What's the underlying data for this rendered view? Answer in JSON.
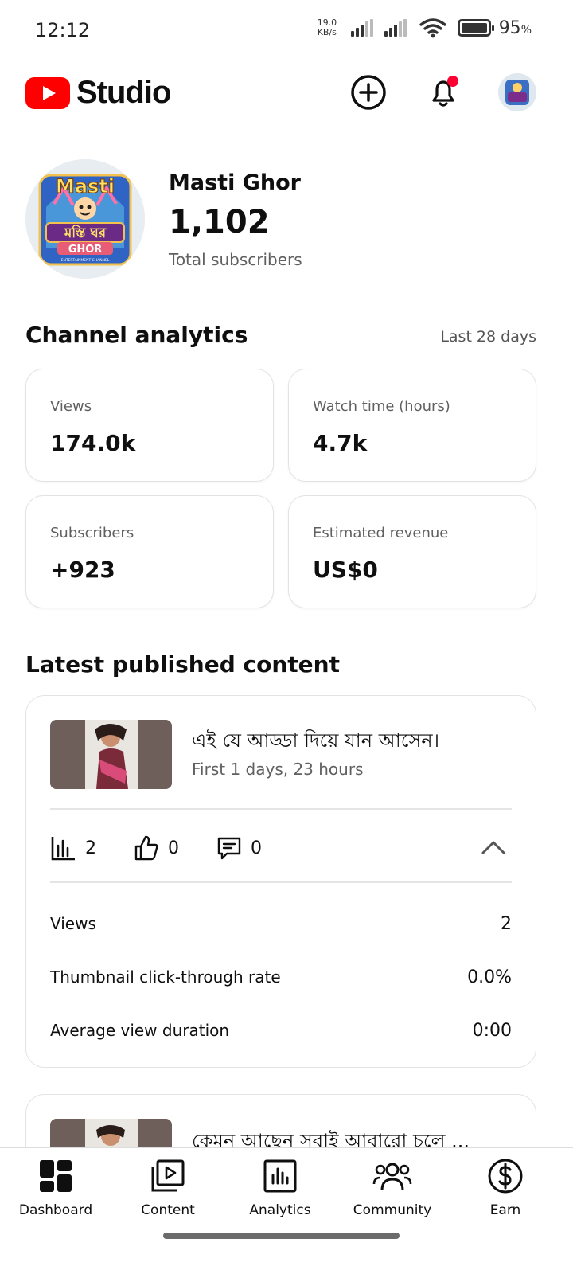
{
  "status_bar": {
    "time": "12:12",
    "net_speed_value": "19.0",
    "net_speed_unit": "KB/s",
    "battery": "95",
    "battery_unit": "%"
  },
  "header": {
    "app_name": "Studio",
    "brand_color": "#FF0000",
    "notification_dot_color": "#FF0033"
  },
  "channel": {
    "name": "Masti Ghor",
    "subscriber_count": "1,102",
    "subscriber_label": "Total subscribers",
    "logo_text_top": "Masti",
    "logo_text_mid": "মস্তি ঘর",
    "logo_text_bottom": "GHOR",
    "logo_caption": "ENTERTAINMENT CHANNEL"
  },
  "analytics": {
    "title": "Channel analytics",
    "period": "Last 28 days",
    "cards": [
      {
        "label": "Views",
        "value": "174.0k"
      },
      {
        "label": "Watch time (hours)",
        "value": "4.7k"
      },
      {
        "label": "Subscribers",
        "value": "+923"
      },
      {
        "label": "Estimated revenue",
        "value": "US$0"
      }
    ]
  },
  "latest": {
    "title": "Latest published content",
    "video": {
      "title": "এই যে আড্ডা দিয়ে যান  আসেন।",
      "subtitle": "First 1 days, 23 hours",
      "views": "2",
      "likes": "0",
      "comments": "0",
      "details": [
        {
          "label": "Views",
          "value": "2"
        },
        {
          "label": "Thumbnail click-through rate",
          "value": "0.0%"
        },
        {
          "label": "Average view duration",
          "value": "0:00"
        }
      ]
    },
    "next_video": {
      "title": "কেমন আছেন সবাই আবারো চলে ..."
    }
  },
  "nav": {
    "items": [
      {
        "label": "Dashboard",
        "icon": "dashboard-icon"
      },
      {
        "label": "Content",
        "icon": "content-icon"
      },
      {
        "label": "Analytics",
        "icon": "analytics-icon"
      },
      {
        "label": "Community",
        "icon": "community-icon"
      },
      {
        "label": "Earn",
        "icon": "earn-icon"
      }
    ]
  }
}
